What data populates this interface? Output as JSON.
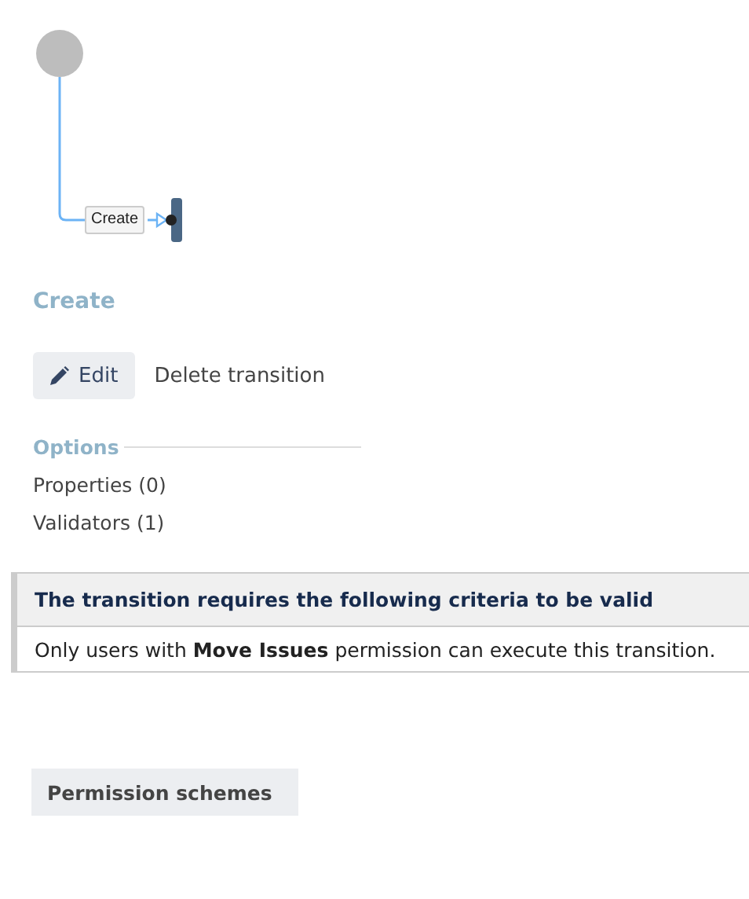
{
  "diagram": {
    "transition_label": "Create"
  },
  "title": "Create",
  "actions": [
    {
      "label": "Edit",
      "kind": "primary"
    },
    {
      "label": "Delete transition",
      "kind": "link"
    }
  ],
  "options": {
    "heading": "Options",
    "items": [
      "Properties (0)",
      "Validators (1)"
    ]
  },
  "criteria": {
    "heading": "The transition requires the following criteria to be valid",
    "text": "Only users with **Move Issues** permission can execute this transition."
  },
  "footer_button": "Permission schemes"
}
